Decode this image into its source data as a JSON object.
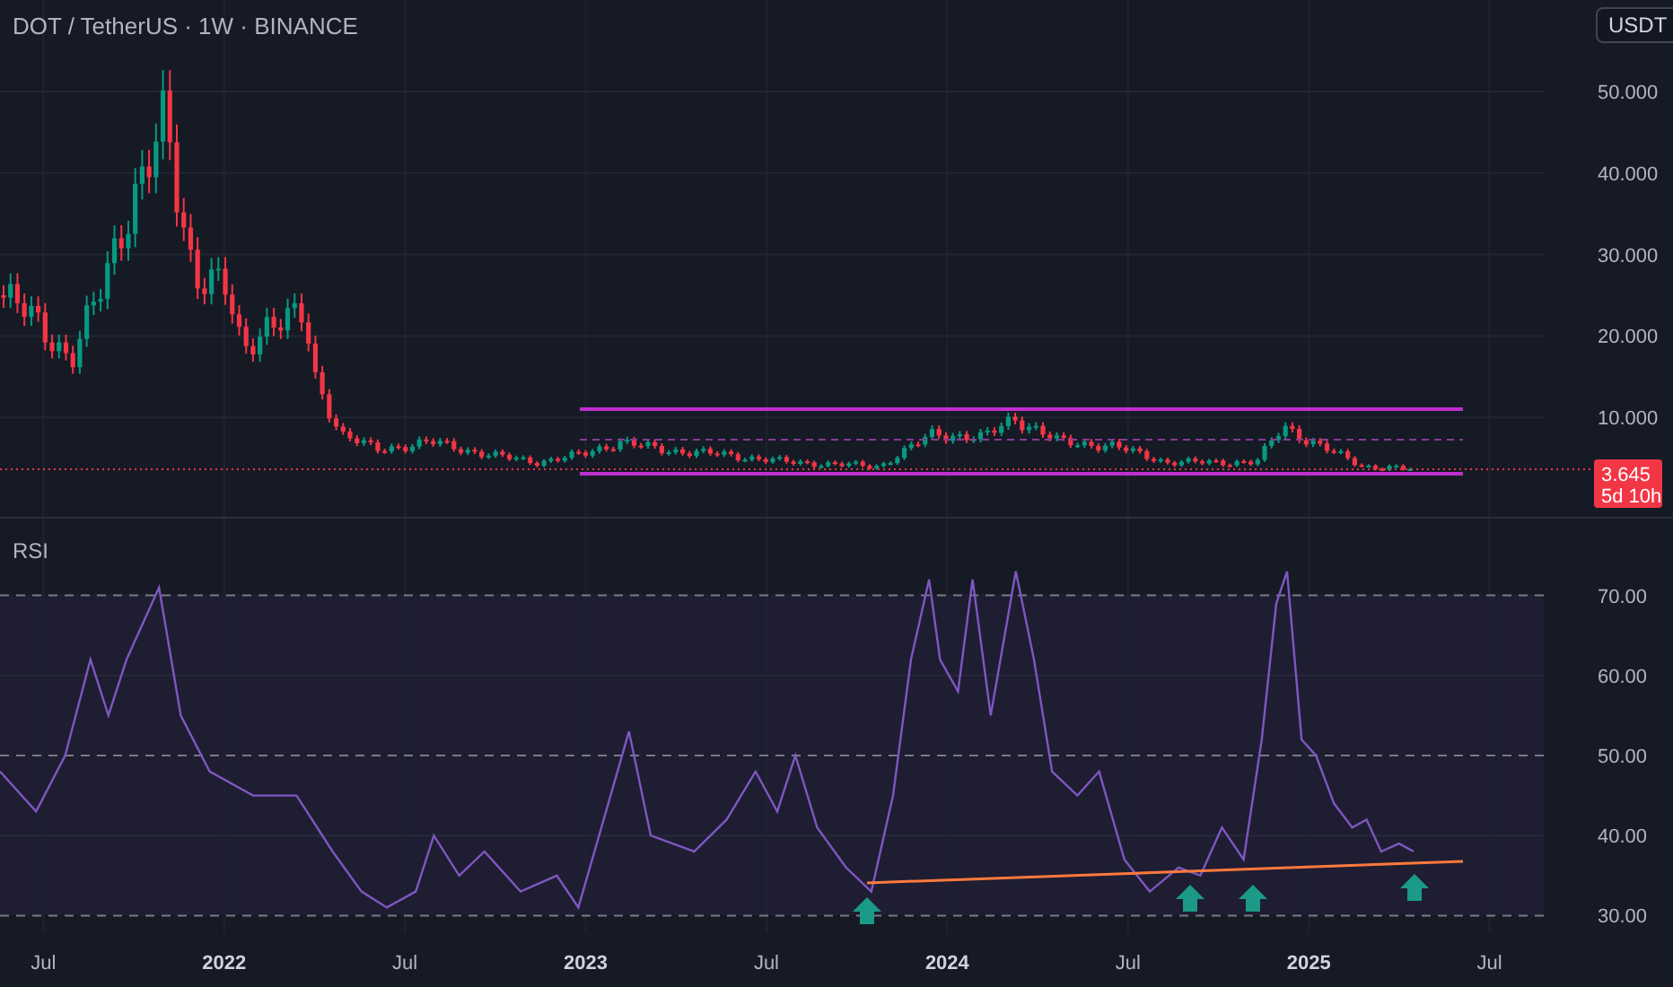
{
  "header": {
    "title": "DOT / TetherUS · 1W · BINANCE",
    "currency_button": "USDT"
  },
  "price_pane": {
    "axis_labels": [
      "50.000",
      "40.000",
      "30.000",
      "20.000",
      "10.000"
    ],
    "last_price": "3.645",
    "countdown": "5d 10h"
  },
  "rsi_pane": {
    "chart_data": {
      "type": "line",
      "xlim": [
        2021.38,
        2025.65
      ],
      "ylim": [
        27.8,
        79.6
      ],
      "grid": true,
      "xticks": [
        {
          "value": 2021.5,
          "label": "Jul"
        },
        {
          "value": 2022,
          "label": "2022"
        },
        {
          "value": 2022.5,
          "label": "Jul"
        },
        {
          "value": 2023,
          "label": "2023"
        },
        {
          "value": 2023.5,
          "label": "Jul"
        },
        {
          "value": 2024,
          "label": "2024"
        },
        {
          "value": 2024.5,
          "label": "Jul"
        },
        {
          "value": 2025,
          "label": "2025"
        },
        {
          "value": 2025.5,
          "label": "Jul"
        }
      ],
      "yticks": [
        {
          "value": 30,
          "label": "30.00"
        },
        {
          "value": 40,
          "label": "40.00"
        },
        {
          "value": 50,
          "label": "50.00"
        },
        {
          "value": 60,
          "label": "60.00"
        },
        {
          "value": 70,
          "label": "70.00"
        }
      ],
      "x": [
        2021.38,
        2021.48,
        2021.56,
        2021.63,
        2021.68,
        2021.73,
        2021.82,
        2021.88,
        2021.96,
        2022.08,
        2022.2,
        2022.3,
        2022.38,
        2022.45,
        2022.53,
        2022.58,
        2022.65,
        2022.72,
        2022.82,
        2022.92,
        2022.98,
        2023.05,
        2023.12,
        2023.18,
        2023.3,
        2023.39,
        2023.47,
        2023.53,
        2023.58,
        2023.64,
        2023.72,
        2023.79,
        2023.85,
        2023.9,
        2023.95,
        2023.98,
        2024.03,
        2024.07,
        2024.12,
        2024.19,
        2024.24,
        2024.29,
        2024.36,
        2024.42,
        2024.49,
        2024.56,
        2024.64,
        2024.7,
        2024.76,
        2024.82,
        2024.87,
        2024.91,
        2024.94,
        2024.98,
        2025.02,
        2025.07,
        2025.12,
        2025.16,
        2025.2,
        2025.25,
        2025.29
      ],
      "series": [
        {
          "name": "RSI",
          "color": "#7e57c2",
          "values": [
            48,
            43,
            50,
            62,
            55,
            62,
            71,
            55,
            48,
            45,
            45,
            38,
            33,
            31,
            33,
            40,
            35,
            38,
            33,
            35,
            31,
            42,
            53,
            40,
            38,
            42,
            48,
            43,
            50,
            41,
            36,
            33,
            45,
            62,
            72,
            62,
            58,
            72,
            55,
            73,
            62,
            48,
            45,
            48,
            37,
            33,
            36,
            35,
            41,
            37,
            52,
            69,
            73,
            52,
            50,
            44,
            41,
            42,
            38,
            39,
            38
          ]
        }
      ]
    }
  }
}
